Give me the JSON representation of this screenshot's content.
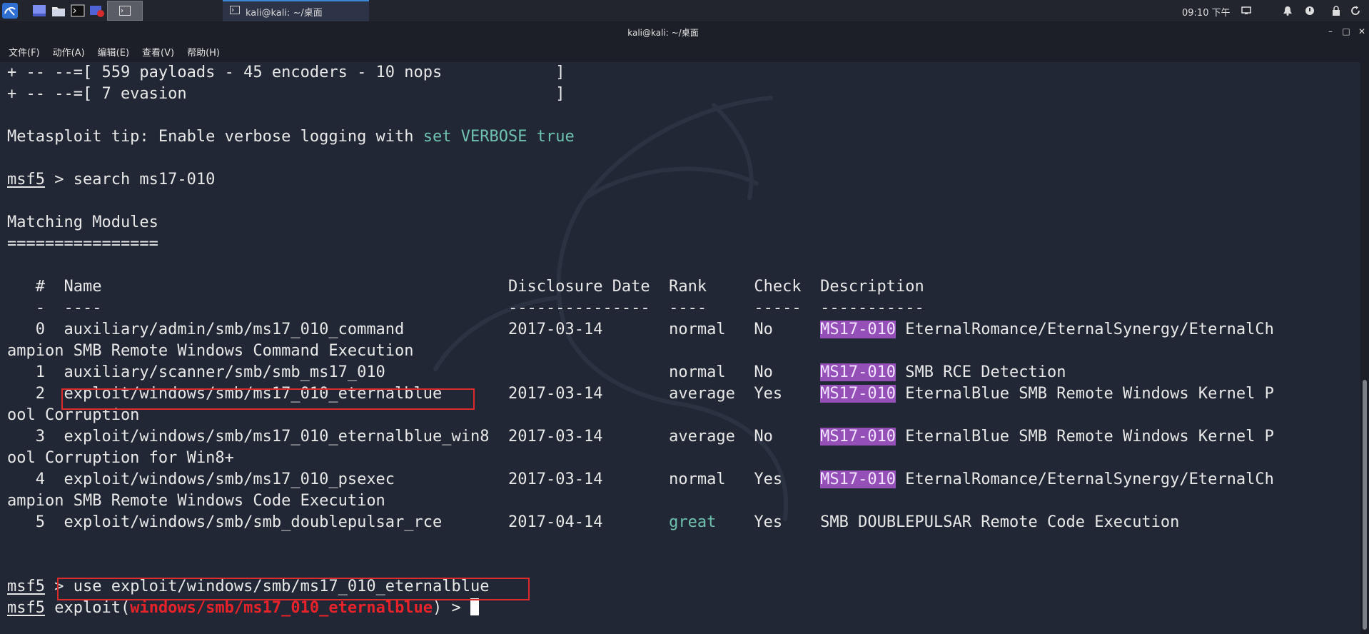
{
  "panel": {
    "launchers": [
      {
        "icon": "kali-menu-icon"
      },
      {
        "icon": "show-desktop-icon"
      },
      {
        "icon": "file-manager-icon"
      },
      {
        "icon": "terminal-icon"
      },
      {
        "icon": "screen-recorder-icon"
      },
      {
        "icon": "workspace-1-icon"
      }
    ],
    "task": {
      "icon": "terminal-icon",
      "label": "kali@kali: ~/桌面"
    },
    "clock": "09:10 下午",
    "tray_icons": [
      "display-icon",
      "bell-icon",
      "power-icon",
      "lock-icon",
      "refresh-icon"
    ]
  },
  "window": {
    "title": "kali@kali: ~/桌面",
    "controls": {
      "minimize": "–",
      "maximize": "□",
      "close": "✕"
    }
  },
  "menu": [
    "文件(F)",
    "动作(A)",
    "编辑(E)",
    "查看(V)",
    "帮助(H)"
  ],
  "terminal": {
    "banner1": "+ -- --=[ 559 payloads - 45 encoders - 10 nops            ]",
    "banner2": "+ -- --=[ 7 evasion                                       ]",
    "tip_prefix": "Metasploit tip: Enable verbose logging with ",
    "tip_cmd": "set VERBOSE true",
    "prompt": "msf5",
    "search_cmd": " > search ms17-010",
    "matching_title": "Matching Modules",
    "matching_rule": "================",
    "header": "   #  Name                                           Disclosure Date  Rank     Check  Description",
    "header_rule": "   -  ----                                           ---------------  ----     -----  -----------",
    "rows": {
      "r0_a": "   0  auxiliary/admin/smb/ms17_010_command           2017-03-14       normal   No     ",
      "r0_b": " EternalRomance/EternalSynergy/EternalCh",
      "r0_c": "ampion SMB Remote Windows Command Execution",
      "r1_a": "   1  auxiliary/scanner/smb/smb_ms17_010                              normal   No     ",
      "r1_b": " SMB RCE Detection",
      "r2_a": "   2  exploit/windows/smb/ms17_010_eternalblue       2017-03-14       average  Yes    ",
      "r2_b": " EternalBlue SMB Remote Windows Kernel P",
      "r2_c": "ool Corruption",
      "r3_a": "   3  exploit/windows/smb/ms17_010_eternalblue_win8  2017-03-14       average  No     ",
      "r3_b": " EternalBlue SMB Remote Windows Kernel P",
      "r3_c": "ool Corruption for Win8+",
      "r4_a": "   4  exploit/windows/smb/ms17_010_psexec            2017-03-14       normal   Yes    ",
      "r4_b": " EternalRomance/EternalSynergy/EternalCh",
      "r4_c": "ampion SMB Remote Windows Code Execution",
      "r5_a": "   5  exploit/windows/smb/smb_doublepulsar_rce       2017-04-14       ",
      "r5_rank": "great",
      "r5_b": "    Yes    SMB DOUBLEPULSAR Remote Code Execution"
    },
    "ms_tag": "MS17-010",
    "use_cmd": " > use exploit/windows/smb/ms17_010_eternalblue",
    "exploit_prefix": " exploit(",
    "exploit_module": "windows/smb/ms17_010_eternalblue",
    "exploit_suffix": ") > "
  },
  "colors": {
    "terminal_bg": "#212734",
    "highlight": "#9550b8",
    "teal": "#6fc1b0",
    "red": "#e8222a"
  }
}
